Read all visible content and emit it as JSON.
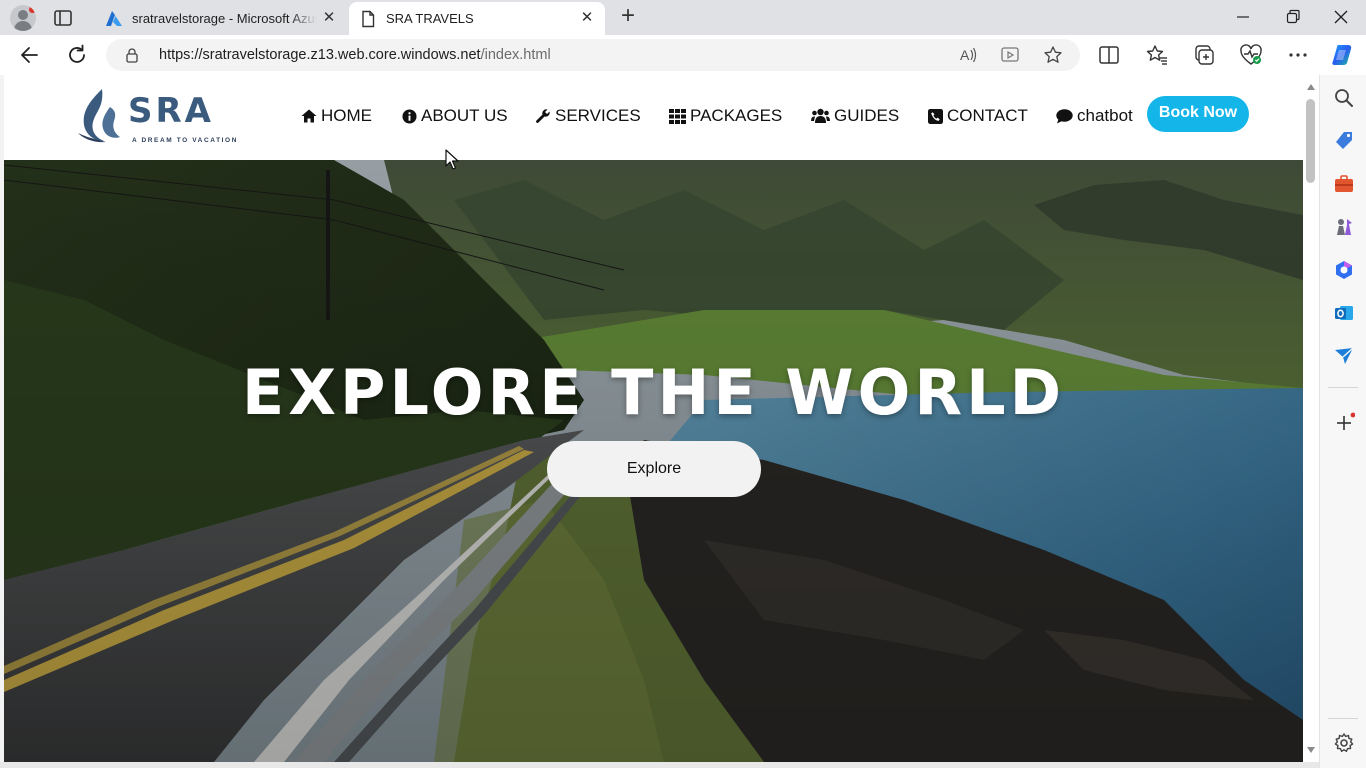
{
  "browser": {
    "tabs": [
      {
        "title": "sratravelstorage - Microsoft Azure",
        "active": false,
        "favicon": "azure-logo-icon"
      },
      {
        "title": "SRA TRAVELS",
        "active": true,
        "favicon": "page-icon"
      }
    ],
    "new_tab_label": "+",
    "url_host": "https://sratravelstorage.z13.web.core.windows.net",
    "url_path": "/index.html"
  },
  "site": {
    "logo_text": "SRA",
    "logo_tagline": "A DREAM TO VACATION",
    "nav": [
      {
        "label": "HOME",
        "icon": "home-icon"
      },
      {
        "label": "ABOUT US",
        "icon": "info-circle-icon"
      },
      {
        "label": "SERVICES",
        "icon": "wrench-icon"
      },
      {
        "label": "PACKAGES",
        "icon": "grid-icon"
      },
      {
        "label": "GUIDES",
        "icon": "users-icon"
      },
      {
        "label": "CONTACT",
        "icon": "phone-square-icon"
      },
      {
        "label": "chatbot",
        "icon": "comment-icon"
      }
    ],
    "book_now": "Book Now",
    "hero_title": "EXPLORE THE WORLD",
    "hero_button": "Explore"
  },
  "colors": {
    "accent": "#14b6ea",
    "logo_blue": "#3a5a7e"
  }
}
